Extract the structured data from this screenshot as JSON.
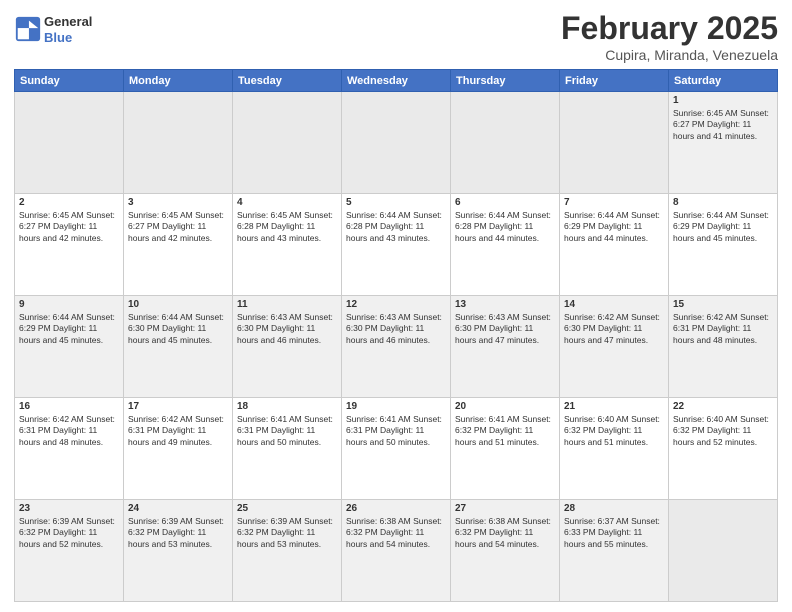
{
  "logo": {
    "line1": "General",
    "line2": "Blue"
  },
  "header": {
    "month": "February 2025",
    "location": "Cupira, Miranda, Venezuela"
  },
  "weekdays": [
    "Sunday",
    "Monday",
    "Tuesday",
    "Wednesday",
    "Thursday",
    "Friday",
    "Saturday"
  ],
  "weeks": [
    [
      {
        "day": "",
        "info": ""
      },
      {
        "day": "",
        "info": ""
      },
      {
        "day": "",
        "info": ""
      },
      {
        "day": "",
        "info": ""
      },
      {
        "day": "",
        "info": ""
      },
      {
        "day": "",
        "info": ""
      },
      {
        "day": "1",
        "info": "Sunrise: 6:45 AM\nSunset: 6:27 PM\nDaylight: 11 hours and 41 minutes."
      }
    ],
    [
      {
        "day": "2",
        "info": "Sunrise: 6:45 AM\nSunset: 6:27 PM\nDaylight: 11 hours and 42 minutes."
      },
      {
        "day": "3",
        "info": "Sunrise: 6:45 AM\nSunset: 6:27 PM\nDaylight: 11 hours and 42 minutes."
      },
      {
        "day": "4",
        "info": "Sunrise: 6:45 AM\nSunset: 6:28 PM\nDaylight: 11 hours and 43 minutes."
      },
      {
        "day": "5",
        "info": "Sunrise: 6:44 AM\nSunset: 6:28 PM\nDaylight: 11 hours and 43 minutes."
      },
      {
        "day": "6",
        "info": "Sunrise: 6:44 AM\nSunset: 6:28 PM\nDaylight: 11 hours and 44 minutes."
      },
      {
        "day": "7",
        "info": "Sunrise: 6:44 AM\nSunset: 6:29 PM\nDaylight: 11 hours and 44 minutes."
      },
      {
        "day": "8",
        "info": "Sunrise: 6:44 AM\nSunset: 6:29 PM\nDaylight: 11 hours and 45 minutes."
      }
    ],
    [
      {
        "day": "9",
        "info": "Sunrise: 6:44 AM\nSunset: 6:29 PM\nDaylight: 11 hours and 45 minutes."
      },
      {
        "day": "10",
        "info": "Sunrise: 6:44 AM\nSunset: 6:30 PM\nDaylight: 11 hours and 45 minutes."
      },
      {
        "day": "11",
        "info": "Sunrise: 6:43 AM\nSunset: 6:30 PM\nDaylight: 11 hours and 46 minutes."
      },
      {
        "day": "12",
        "info": "Sunrise: 6:43 AM\nSunset: 6:30 PM\nDaylight: 11 hours and 46 minutes."
      },
      {
        "day": "13",
        "info": "Sunrise: 6:43 AM\nSunset: 6:30 PM\nDaylight: 11 hours and 47 minutes."
      },
      {
        "day": "14",
        "info": "Sunrise: 6:42 AM\nSunset: 6:30 PM\nDaylight: 11 hours and 47 minutes."
      },
      {
        "day": "15",
        "info": "Sunrise: 6:42 AM\nSunset: 6:31 PM\nDaylight: 11 hours and 48 minutes."
      }
    ],
    [
      {
        "day": "16",
        "info": "Sunrise: 6:42 AM\nSunset: 6:31 PM\nDaylight: 11 hours and 48 minutes."
      },
      {
        "day": "17",
        "info": "Sunrise: 6:42 AM\nSunset: 6:31 PM\nDaylight: 11 hours and 49 minutes."
      },
      {
        "day": "18",
        "info": "Sunrise: 6:41 AM\nSunset: 6:31 PM\nDaylight: 11 hours and 50 minutes."
      },
      {
        "day": "19",
        "info": "Sunrise: 6:41 AM\nSunset: 6:31 PM\nDaylight: 11 hours and 50 minutes."
      },
      {
        "day": "20",
        "info": "Sunrise: 6:41 AM\nSunset: 6:32 PM\nDaylight: 11 hours and 51 minutes."
      },
      {
        "day": "21",
        "info": "Sunrise: 6:40 AM\nSunset: 6:32 PM\nDaylight: 11 hours and 51 minutes."
      },
      {
        "day": "22",
        "info": "Sunrise: 6:40 AM\nSunset: 6:32 PM\nDaylight: 11 hours and 52 minutes."
      }
    ],
    [
      {
        "day": "23",
        "info": "Sunrise: 6:39 AM\nSunset: 6:32 PM\nDaylight: 11 hours and 52 minutes."
      },
      {
        "day": "24",
        "info": "Sunrise: 6:39 AM\nSunset: 6:32 PM\nDaylight: 11 hours and 53 minutes."
      },
      {
        "day": "25",
        "info": "Sunrise: 6:39 AM\nSunset: 6:32 PM\nDaylight: 11 hours and 53 minutes."
      },
      {
        "day": "26",
        "info": "Sunrise: 6:38 AM\nSunset: 6:32 PM\nDaylight: 11 hours and 54 minutes."
      },
      {
        "day": "27",
        "info": "Sunrise: 6:38 AM\nSunset: 6:32 PM\nDaylight: 11 hours and 54 minutes."
      },
      {
        "day": "28",
        "info": "Sunrise: 6:37 AM\nSunset: 6:33 PM\nDaylight: 11 hours and 55 minutes."
      },
      {
        "day": "",
        "info": ""
      }
    ]
  ]
}
